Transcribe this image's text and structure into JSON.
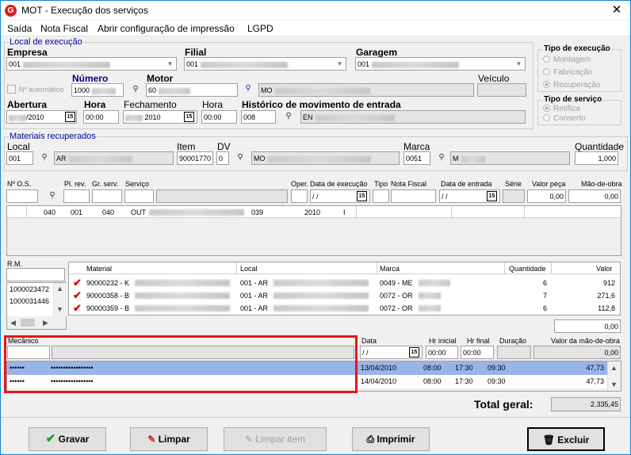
{
  "window": {
    "title": "MOT - Execução dos serviços",
    "close": "✕",
    "app_icon": "G"
  },
  "menu": [
    "Saída",
    "Nota Fiscal",
    "Abrir configuração de impressão",
    "LGPD"
  ],
  "local_execucao": {
    "group_label": "Local de execução",
    "empresa": {
      "label": "Empresa",
      "value": "001"
    },
    "filial": {
      "label": "Filial",
      "value": "001"
    },
    "garagem": {
      "label": "Garagem",
      "value": "001"
    },
    "tipo_execucao": {
      "label": "Tipo de execução",
      "options": [
        "Montagem",
        "Fabricação",
        "Recuperação"
      ],
      "selected": 2
    },
    "numero_automatico": {
      "label": "Nº automático"
    },
    "numero": {
      "label": "Número",
      "value": "1000"
    },
    "motor": {
      "label": "Motor",
      "value": "60",
      "desc": "MO"
    },
    "veiculo": {
      "label": "Veículo",
      "value": ""
    },
    "abertura": {
      "label": "Abertura",
      "value": "/2010"
    },
    "hora_abertura": {
      "label": "Hora",
      "value": "00:00"
    },
    "fechamento": {
      "label": "Fechamento",
      "value": "2010"
    },
    "hora_fechamento": {
      "label": "Hora",
      "value": "00:00"
    },
    "historico": {
      "label": "Histórico de movimento de entrada",
      "value": "008",
      "desc": "EN"
    },
    "tipo_servico": {
      "label": "Tipo de serviço",
      "options": [
        "Retífica",
        "Conserto"
      ],
      "selected": 0
    }
  },
  "materiais": {
    "group_label": "Materiais recuperados",
    "local": {
      "label": "Local",
      "value": "001",
      "desc": "AR"
    },
    "item": {
      "label": "Item",
      "value": "90001770"
    },
    "dv": {
      "label": "DV",
      "value": "0"
    },
    "item_desc": "MO",
    "marca": {
      "label": "Marca",
      "value": "0051",
      "desc": "M"
    },
    "quantidade": {
      "label": "Quantidade",
      "value": "1,000"
    }
  },
  "servico": {
    "headers": {
      "os": "Nº O.S.",
      "pl_rev": "Pl. rev.",
      "gr_serv": "Gr. serv.",
      "servico": "Serviço",
      "oper": "Oper.",
      "data_exec": "Data de execução",
      "tipo": "Tipo",
      "nota_fiscal": "Nota Fiscal",
      "data_entrada": "Data de entrada",
      "serie": "Série",
      "valor_peca": "Valor peça",
      "mao_obra": "Mão-de-obra"
    },
    "data_exec_value": "/ /",
    "data_entrada_value": "/ /",
    "valor_peca_value": "0,00",
    "mao_obra_value": "0,00",
    "row": {
      "c1": "040",
      "c2": "001",
      "c3": "040",
      "c4": "OUT",
      "c5": "039",
      "c6": "2010",
      "c7": "I"
    }
  },
  "rm": {
    "label": "R.M.",
    "items": [
      "1000023472",
      "1000031446"
    ]
  },
  "materials_table": {
    "headers": {
      "material": "Material",
      "local": "Local",
      "marca": "Marca",
      "quantidade": "Quantidade",
      "valor": "Valor"
    },
    "rows": [
      {
        "material": "90000232 - K",
        "local": "001 - AR",
        "marca": "0049 - ME",
        "quantidade": "6",
        "valor": "912"
      },
      {
        "material": "90000358 - B",
        "local": "001 - AR",
        "marca": "0072 - OR",
        "quantidade": "7",
        "valor": "271,6"
      },
      {
        "material": "90000359 - B",
        "local": "001 - AR",
        "marca": "0072 - OR",
        "quantidade": "6",
        "valor": "112,8"
      }
    ],
    "total": "0,00"
  },
  "mecanico": {
    "label": "Mecânico",
    "headers": {
      "data": "Data",
      "hr_inicial": "Hr inicial",
      "hr_final": "Hr final",
      "duracao": "Duração",
      "valor": "Valor da mão-de-obra"
    },
    "inputs": {
      "data": "/ /",
      "hr_inicial": "00:00",
      "hr_final": "00:00",
      "valor": "0,00"
    },
    "rows": [
      {
        "codigo": "••••••",
        "nome": "•••••••••••••••••",
        "data": "13/04/2010",
        "hr_inicial": "08:00",
        "hr_final": "17:30",
        "duracao": "09:30",
        "valor": "47,73"
      },
      {
        "codigo": "••••••",
        "nome": "•••••••••••••••••",
        "data": "14/04/2010",
        "hr_inicial": "08:00",
        "hr_final": "17:30",
        "duracao": "09:30",
        "valor": "47,73"
      }
    ]
  },
  "total_geral": {
    "label": "Total geral:",
    "value": "2.335,45"
  },
  "buttons": {
    "gravar": "Gravar",
    "limpar": "Limpar",
    "limpar_item": "Limpar item",
    "imprimir": "Imprimir",
    "excluir": "Excluir"
  },
  "colors": {
    "highlight_row": "#99b4e8",
    "red_box": "#e8141c",
    "group_label": "#0000a0"
  }
}
